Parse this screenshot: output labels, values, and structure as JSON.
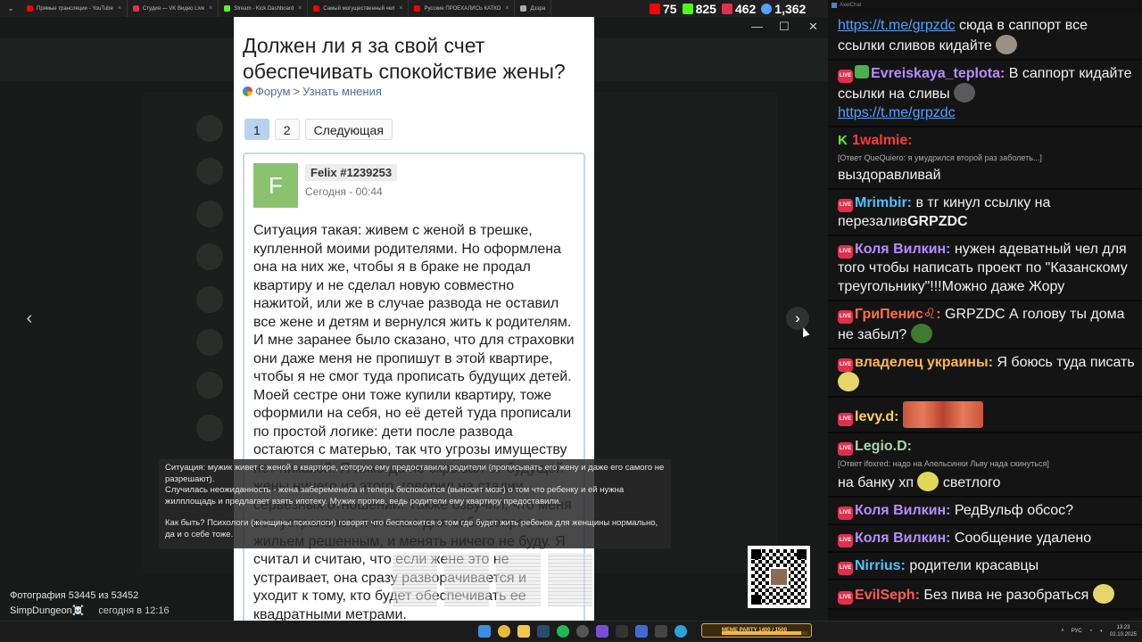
{
  "browser": {
    "tabs": [
      {
        "label": "Прямые трансляции - YouTube",
        "color": "#ff0000"
      },
      {
        "label": "Студия — VK Видео Live",
        "color": "#e0304c"
      },
      {
        "label": "Stream - Kick Dashboard",
        "color": "#53fc18"
      },
      {
        "label": "Самый могущественный чел",
        "color": "#ff0000"
      },
      {
        "label": "Русские ПРОЕХАЛИСЬ КАТКО",
        "color": "#ff0000"
      },
      {
        "label": "Дзэра",
        "color": "#aaaaaa"
      }
    ],
    "tab_menu_icon": "chevron-down-icon"
  },
  "stream_stats": [
    {
      "platform": "youtube",
      "color": "#ff0000",
      "value": "75"
    },
    {
      "platform": "kick",
      "color": "#53fc18",
      "value": "825"
    },
    {
      "platform": "vk",
      "color": "#e0304c",
      "value": "462"
    },
    {
      "platform": "total",
      "color": "#4fa3ff",
      "value": "1,362"
    }
  ],
  "thread": {
    "title": "Должен ли я за свой счет обеспечивать спокойствие жены?",
    "breadcrumb": [
      "Форум",
      ">",
      "Узнать мнения"
    ],
    "pages": [
      "1",
      "2"
    ],
    "next_label": "Следующая",
    "post": {
      "avatar_letter": "F",
      "author": "Felix #1239253",
      "time": "Сегодня - 00:44",
      "text": "Ситуация такая: живем с женой в трешке, купленной моими родителями. Но оформлена она на них же, чтобы я в браке не продал квартиру и не сделал новую совместно нажитой, или же в случае развода не оставил все жене и детям и вернулся жить к родителям. И мне заранее было сказано, что для страховки они даже меня не пропишут в этой квартире, чтобы я не смог туда прописать будущих детей. Моей сестре они тоже купили квартиру, тоже оформили на себя, но её детей туда прописали по простой логике: дети после развода остаются с матерью, так что угрозы имуществу нет никакой. Я никогда не скрывал от будущей жены ничего из этого, говорил на стадии серьезных отношений. Также озвучил, что меня все устраивает, я считаю для себя вопрос с жильем решенным, и менять ничего не буду. Я считал и считаю, что если жене это не устраивает, она сразу разворачивается и уходит к тому, кто будет обеспечивать ее квадратными метрами."
    }
  },
  "caption": {
    "line1": "Ситуация: мужик живет с женой в квартире, которую ему предоставили родители (прописывать его жену и даже его самого не разрешают).",
    "line2": "Случилась неожиданность - жена забеременела и теперь беспокоится (выносит мозг) о том что ребенку и ей нужна жилплощадь и предлагает взять ипотеку. Мужик против, ведь родители ему квартиру предоставили.",
    "line3": "Как быть? Психологи (женщины психологи) говорят что беспокоится о том где будет жить ребенок для женщины нормально, да и о себе тоже."
  },
  "photo_info": {
    "counter": "Фотография 53445 из 53452",
    "owner": "SimpDungeon☠️",
    "when": "сегодня в 12:16"
  },
  "chat": {
    "window_title": "AxelChat",
    "messages": [
      {
        "badge": "none",
        "nick": "",
        "nick_color": "#ffffff",
        "link": "https://t.me/grpzdc",
        "text": " сюда в саппорт все ссылки сливов кидайте",
        "reply": "",
        "emote": "#9c8f85"
      },
      {
        "badge": "live+green",
        "nick": "Evreiskaya_teplota:",
        "nick_color": "#b98cff",
        "text": " В саппорт кидайте ссылки на сливы",
        "link2": "https://t.me/grpzdc",
        "reply": "",
        "emote": "#5a5a5a"
      },
      {
        "badge": "kick",
        "nick": "1walmie:",
        "nick_color": "#ff3b3b",
        "text": "выздоравливай",
        "reply": "[Ответ QueQuiero: я умудрился второй раз заболеть...]"
      },
      {
        "badge": "live",
        "nick": "Mrimbir:",
        "nick_color": "#4fc3f7",
        "text": " в тг кинул ссылку на перезалив",
        "bold_tail": "GRPZDC",
        "reply": ""
      },
      {
        "badge": "live",
        "nick": "Коля Вилкин:",
        "nick_color": "#b98cff",
        "text": " нужен адеватный чел для того чтобы написать проект по \"Казанскому треугольнику\"!!!Можно даже Жору",
        "reply": ""
      },
      {
        "badge": "live",
        "nick": "ГриПенис♌:",
        "nick_color": "#ff6f4a",
        "text": " GRPZDC А голову ты дома не забыл?",
        "reply": "",
        "emote": "#3f7a2e"
      },
      {
        "badge": "live",
        "nick": "владелец украины:",
        "nick_color": "#ffb74d",
        "text": " Я боюсь туда писать",
        "reply": "",
        "emote": "#e6d56b"
      },
      {
        "badge": "live",
        "nick": "levy.d:",
        "nick_color": "#ffd54f",
        "text": "",
        "reply": "",
        "wide": true
      },
      {
        "badge": "live",
        "nick": "Legio.D:",
        "nick_color": "#a5d6a7",
        "text": "на банку хп",
        "text2": "светлого",
        "reply": "[Ответ ifoxred: надо на Апельсинки Льву нада скинуться]",
        "emote": "#e0d65a"
      },
      {
        "badge": "live",
        "nick": "Коля Вилкин:",
        "nick_color": "#b98cff",
        "text": " РедВульф обсос?",
        "reply": ""
      },
      {
        "badge": "live",
        "nick": "Коля Вилкин:",
        "nick_color": "#b98cff",
        "text": " Сообщение удалено",
        "reply": ""
      },
      {
        "badge": "live",
        "nick": "Nirrius:",
        "nick_color": "#4fc3f7",
        "text": " родители красавцы",
        "reply": ""
      },
      {
        "badge": "live",
        "nick": "EvilSeph:",
        "nick_color": "#ff5a5a",
        "text": " Без пива не разобраться",
        "reply": "",
        "emote": "#e6d56b"
      }
    ]
  },
  "taskbar": {
    "meme_label": "MEME PARTY",
    "meme_progress": "1400 / 1500",
    "meme_fill": 0.93,
    "lang": "РУС",
    "time": "13:23",
    "date": "02.10.2025"
  }
}
